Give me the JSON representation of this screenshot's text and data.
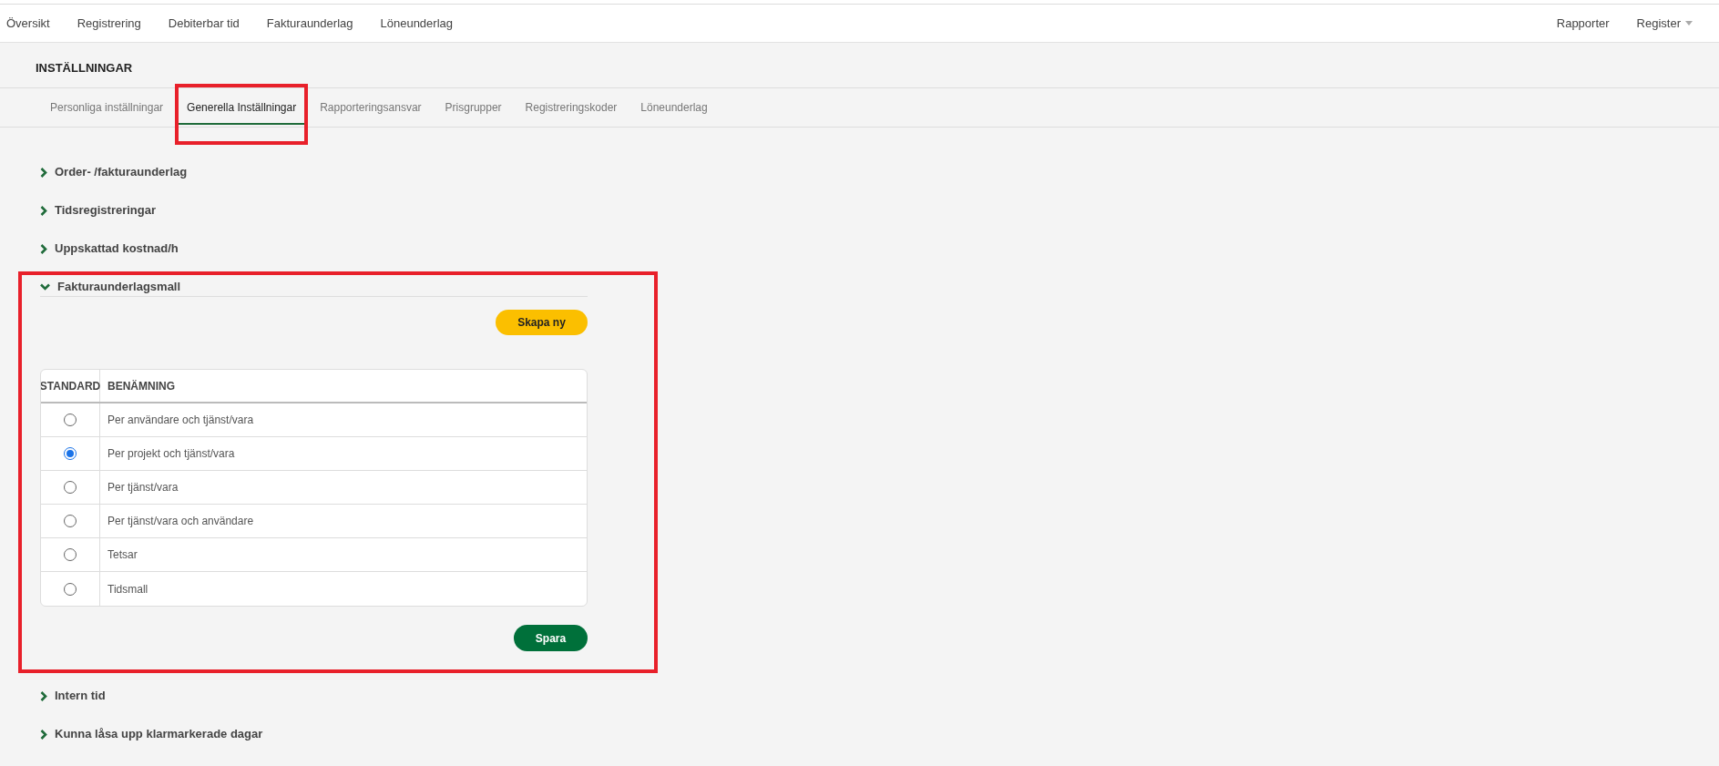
{
  "top_nav": {
    "left": [
      {
        "label": "Översikt"
      },
      {
        "label": "Registrering"
      },
      {
        "label": "Debiterbar tid"
      },
      {
        "label": "Fakturaunderlag"
      },
      {
        "label": "Löneunderlag"
      }
    ],
    "right": [
      {
        "label": "Rapporter"
      },
      {
        "label": "Register",
        "dropdown": true
      }
    ]
  },
  "page_title": "INSTÄLLNINGAR",
  "tabs": [
    {
      "label": "Personliga inställningar",
      "selected": false
    },
    {
      "label": "Generella Inställningar",
      "selected": true,
      "highlighted": true
    },
    {
      "label": "Rapporteringsansvar",
      "selected": false
    },
    {
      "label": "Prisgrupper",
      "selected": false
    },
    {
      "label": "Registreringskoder",
      "selected": false
    },
    {
      "label": "Löneunderlag",
      "selected": false
    }
  ],
  "sections": [
    {
      "title": "Order- /fakturaunderlag",
      "expanded": false
    },
    {
      "title": "Tidsregistreringar",
      "expanded": false
    },
    {
      "title": "Uppskattad kostnad/h",
      "expanded": false
    },
    {
      "title": "Fakturaunderlagsmall",
      "expanded": true,
      "highlighted": true,
      "create_button": "Skapa ny",
      "table": {
        "columns": [
          "STANDARD",
          "BENÄMNING"
        ],
        "rows": [
          {
            "name": "Per användare och tjänst/vara",
            "selected": false
          },
          {
            "name": "Per projekt och tjänst/vara",
            "selected": true
          },
          {
            "name": "Per tjänst/vara",
            "selected": false
          },
          {
            "name": "Per tjänst/vara och användare",
            "selected": false
          },
          {
            "name": "Tetsar",
            "selected": false
          },
          {
            "name": "Tidsmall",
            "selected": false
          }
        ]
      },
      "save_button": "Spara"
    },
    {
      "title": "Intern tid",
      "expanded": false
    },
    {
      "title": "Kunna låsa upp klarmarkerade dagar",
      "expanded": false
    }
  ]
}
